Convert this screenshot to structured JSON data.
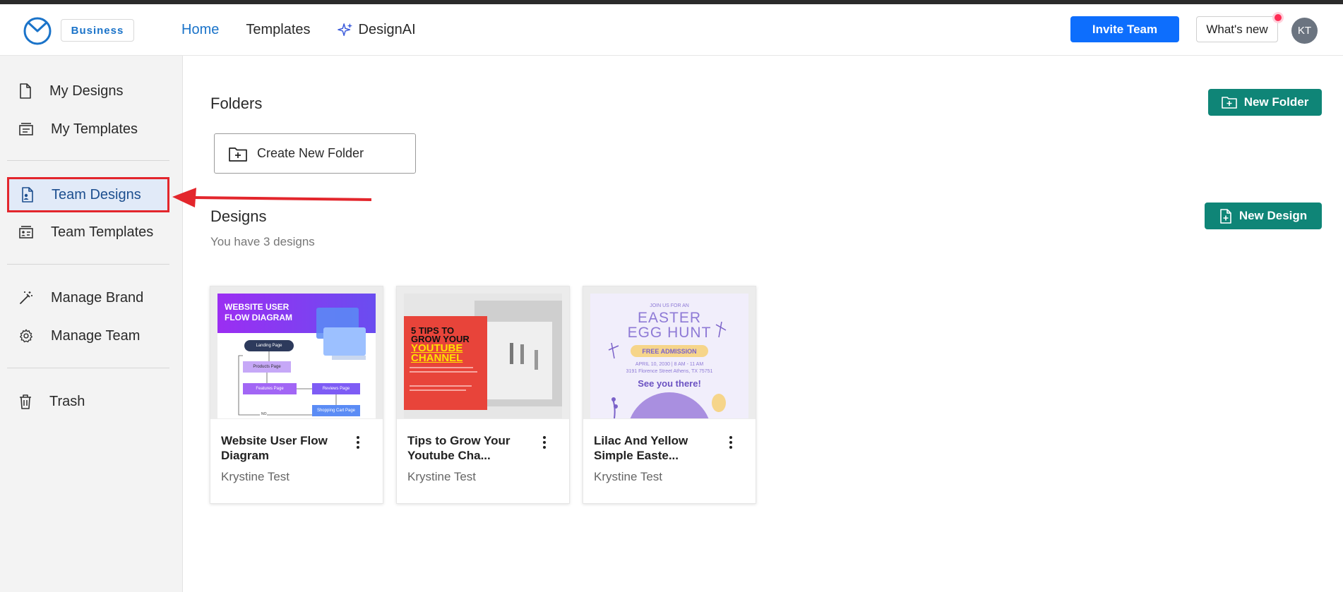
{
  "header": {
    "badge": "Business",
    "nav": [
      {
        "label": "Home",
        "active": true
      },
      {
        "label": "Templates",
        "active": false
      },
      {
        "label": "DesignAI",
        "active": false
      }
    ],
    "invite_label": "Invite Team",
    "whats_new_label": "What's new",
    "avatar_initials": "KT"
  },
  "sidebar": {
    "items": [
      {
        "label": "My Designs",
        "icon": "document-icon"
      },
      {
        "label": "My Templates",
        "icon": "template-icon"
      },
      {
        "label": "Team Designs",
        "icon": "team-document-icon",
        "active": true
      },
      {
        "label": "Team Templates",
        "icon": "team-template-icon"
      },
      {
        "label": "Manage Brand",
        "icon": "magic-wand-icon"
      },
      {
        "label": "Manage Team",
        "icon": "gear-icon"
      },
      {
        "label": "Trash",
        "icon": "trash-icon"
      }
    ]
  },
  "folders": {
    "title": "Folders",
    "new_folder_label": "New Folder",
    "create_folder_label": "Create New Folder"
  },
  "designs": {
    "title": "Designs",
    "count_text": "You have 3 designs",
    "new_design_label": "New Design",
    "cards": [
      {
        "title": "Website User Flow Diagram",
        "author": "Krystine Test",
        "thumb": {
          "heading_line1": "WEBSITE USER",
          "heading_line2": "FLOW DIAGRAM",
          "boxes": [
            "Landing Page",
            "Products Page",
            "Features Page",
            "Reviews Page",
            "Shopping Cart Page"
          ],
          "decision": "NO"
        }
      },
      {
        "title": "Tips to Grow Your Youtube Cha...",
        "author": "Krystine Test",
        "thumb": {
          "line1": "5 TIPS TO",
          "line2": "GROW YOUR",
          "line3": "YOUTUBE",
          "line4": "CHANNEL"
        }
      },
      {
        "title": "Lilac And Yellow Simple Easte...",
        "author": "Krystine Test",
        "thumb": {
          "top": "JOIN US FOR AN",
          "line1": "EASTER",
          "line2": "EGG HUNT",
          "badge": "FREE ADMISSION",
          "date": "APRIL 10, 2030 | 8 AM - 11 AM",
          "address": "3191 Florence Street Athens, TX 75751",
          "cta": "See you there!"
        }
      }
    ]
  },
  "colors": {
    "primary_blue": "#0d6efd",
    "brand_blue": "#1a73c9",
    "green": "#0f8577",
    "highlight_red": "#e3262c"
  }
}
